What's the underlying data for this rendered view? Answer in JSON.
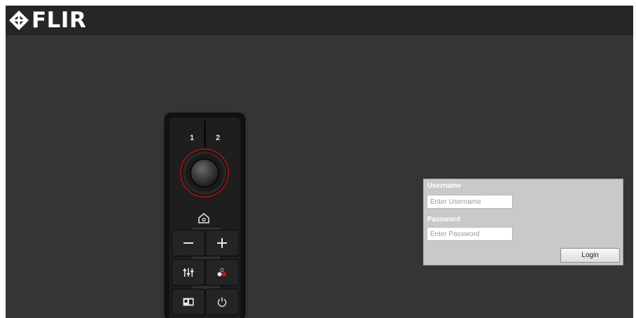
{
  "header": {
    "logo_text": "FLIR"
  },
  "remote": {
    "preset_1": "1",
    "preset_2": "2",
    "icons": [
      "home-icon",
      "minus-icon",
      "plus-icon",
      "adjust-sliders-icon",
      "palette-icon",
      "picture-in-picture-icon",
      "power-icon"
    ],
    "accent_color": "#b01818"
  },
  "login": {
    "username_label": "Username",
    "username_placeholder": "Enter Username",
    "password_label": "Password",
    "password_placeholder": "Enter Password",
    "login_button": "Login"
  }
}
